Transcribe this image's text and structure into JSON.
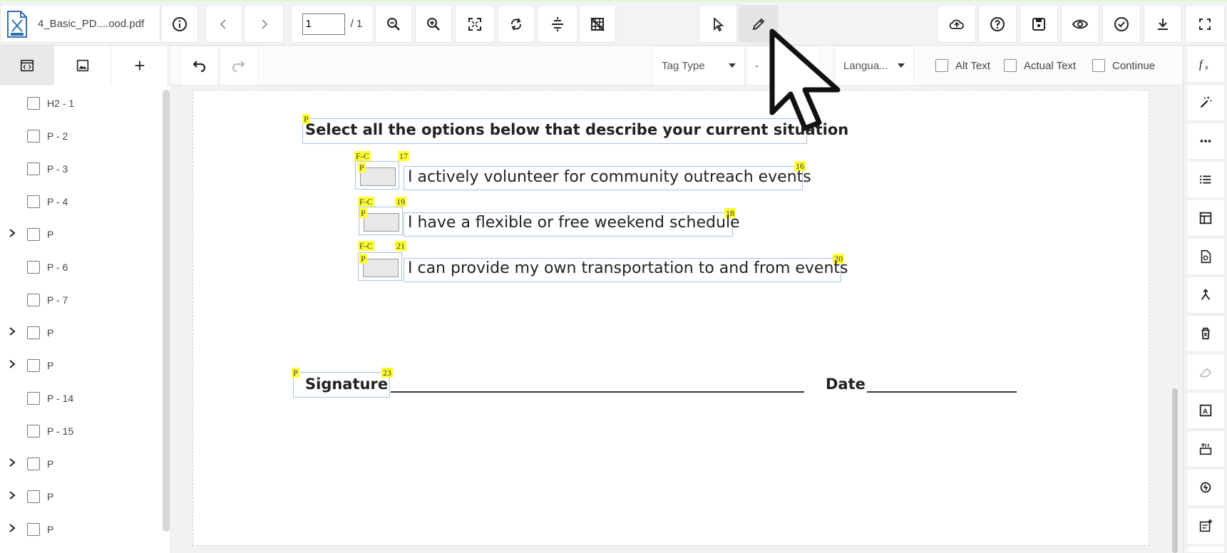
{
  "file": {
    "name": "4_Basic_PD....ood.pdf"
  },
  "toolbar": {
    "page_current": "1",
    "page_total": "/ 1"
  },
  "row2": {
    "tag_type_label": "Tag Type",
    "dash": "-",
    "language_label": "Langua...",
    "alt_text_label": "Alt Text",
    "actual_text_label": "Actual Text",
    "continue_label": "Continue"
  },
  "tree": {
    "items": [
      {
        "label": "H2 - 1",
        "expandable": false
      },
      {
        "label": "P - 2",
        "expandable": false
      },
      {
        "label": "P - 3",
        "expandable": false
      },
      {
        "label": "P - 4",
        "expandable": false
      },
      {
        "label": "P",
        "expandable": true
      },
      {
        "label": "P - 6",
        "expandable": false
      },
      {
        "label": "P - 7",
        "expandable": false
      },
      {
        "label": "P",
        "expandable": true
      },
      {
        "label": "P",
        "expandable": true
      },
      {
        "label": "P - 14",
        "expandable": false
      },
      {
        "label": "P - 15",
        "expandable": false
      },
      {
        "label": "P",
        "expandable": true
      },
      {
        "label": "P",
        "expandable": true
      },
      {
        "label": "P",
        "expandable": true
      }
    ]
  },
  "document": {
    "heading": "Select all the options below that describe your current situation",
    "options": [
      {
        "text": "I actively volunteer for community outreach events",
        "form_tag": "F-C",
        "form_num": "17",
        "p_tag": "P",
        "text_num": "16"
      },
      {
        "text": "I have a flexible or free weekend schedule",
        "form_tag": "F-C",
        "form_num": "19",
        "p_tag": "P",
        "text_num": "18"
      },
      {
        "text": "I can provide my own transportation to and from events",
        "form_tag": "F-C",
        "form_num": "21",
        "p_tag": "P",
        "text_num": "20"
      }
    ],
    "heading_tag": "P",
    "signature_label": "Signature",
    "signature_tag": "P",
    "signature_num": "23",
    "date_label": "Date"
  },
  "colors": {
    "tag_highlight": "#ffff33",
    "tag_border": "#a9c3de"
  }
}
